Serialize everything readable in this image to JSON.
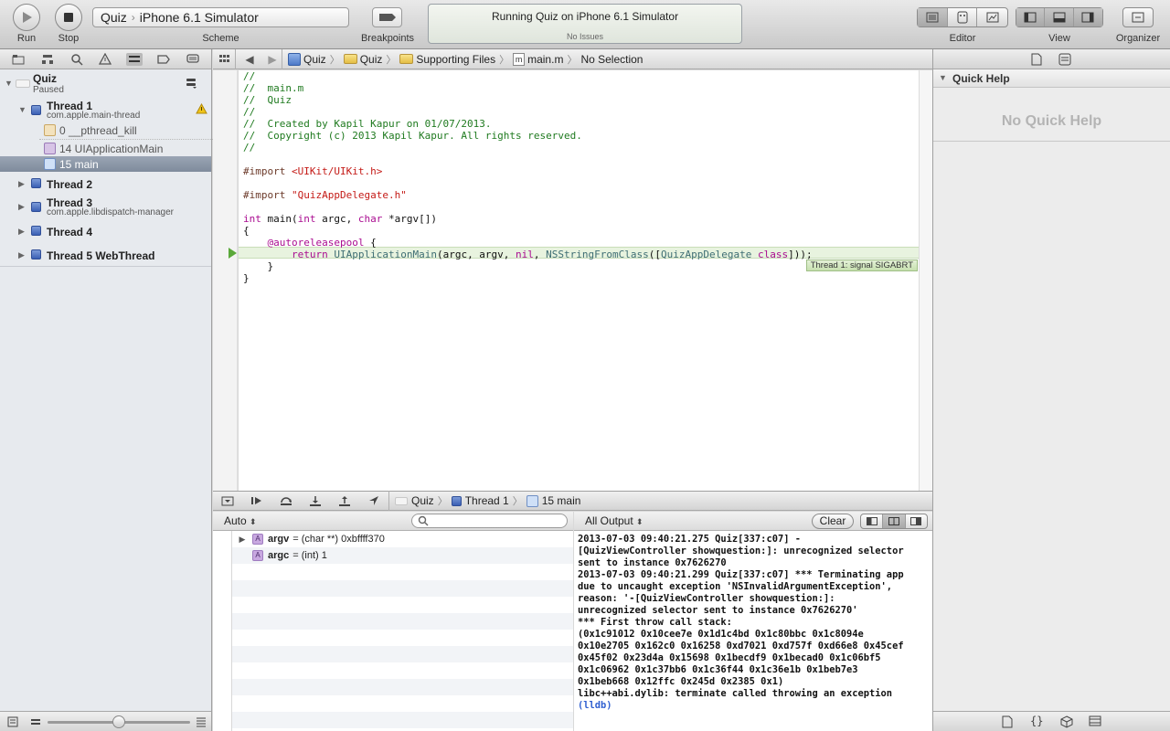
{
  "toolbar": {
    "run_label": "Run",
    "stop_label": "Stop",
    "scheme_label": "Scheme",
    "scheme_project": "Quiz",
    "scheme_destination": "iPhone 6.1 Simulator",
    "breakpoints_label": "Breakpoints",
    "activity_status": "Running Quiz on iPhone 6.1 Simulator",
    "activity_issues": "No Issues",
    "editor_label": "Editor",
    "view_label": "View",
    "organizer_label": "Organizer"
  },
  "navigator": {
    "process_name": "Quiz",
    "process_state": "Paused",
    "threads": [
      {
        "title": "Thread 1",
        "queue": "com.apple.main-thread",
        "expanded": true,
        "warning": true,
        "frames": [
          {
            "label": "0 __pthread_kill"
          },
          {
            "label": "14 UIApplicationMain"
          },
          {
            "label": "15 main",
            "selected": true
          }
        ]
      },
      {
        "title": "Thread 2",
        "queue": ""
      },
      {
        "title": "Thread 3",
        "queue": "com.apple.libdispatch-manager"
      },
      {
        "title": "Thread 4",
        "queue": ""
      },
      {
        "title": "Thread 5 WebThread",
        "queue": ""
      }
    ]
  },
  "jumpbar": {
    "crumbs": [
      "Quiz",
      "Quiz",
      "Supporting Files",
      "main.m",
      "No Selection"
    ]
  },
  "editor": {
    "lines": [
      "//",
      "//  main.m",
      "//  Quiz",
      "//",
      "//  Created by Kapil Kapur on 01/07/2013.",
      "//  Copyright (c) 2013 Kapil Kapur. All rights reserved.",
      "//",
      "",
      "#import <UIKit/UIKit.h>",
      "",
      "#import \"QuizAppDelegate.h\"",
      "",
      "int main(int argc, char *argv[])",
      "{",
      "    @autoreleasepool {",
      "        return UIApplicationMain(argc, argv, nil, NSStringFromClass([QuizAppDelegate class]));",
      "    }",
      "}"
    ],
    "error_badge": "Thread 1: signal SIGABRT"
  },
  "debugbar": {
    "crumbs": [
      "Quiz",
      "Thread 1",
      "15 main"
    ]
  },
  "variables": {
    "scope": "Auto",
    "search_placeholder": "",
    "rows": [
      {
        "name": "argv",
        "value": "= (char **) 0xbffff370",
        "expandable": true
      },
      {
        "name": "argc",
        "value": "= (int) 1",
        "expandable": false
      }
    ]
  },
  "console": {
    "filter": "All Output",
    "clear_label": "Clear",
    "lines": [
      "2013-07-03 09:40:21.275 Quiz[337:c07] -",
      "[QuizViewController showquestion:]: unrecognized selector",
      "sent to instance 0x7626270",
      "2013-07-03 09:40:21.299 Quiz[337:c07] *** Terminating app",
      "due to uncaught exception 'NSInvalidArgumentException',",
      "reason: '-[QuizViewController showquestion:]:",
      "unrecognized selector sent to instance 0x7626270'",
      "*** First throw call stack:",
      "(0x1c91012 0x10cee7e 0x1d1c4bd 0x1c80bbc 0x1c8094e",
      "0x10e2705 0x162c0 0x16258 0xd7021 0xd757f 0xd66e8 0x45cef",
      "0x45f02 0x23d4a 0x15698 0x1becdf9 0x1becad0 0x1c06bf5",
      "0x1c06962 0x1c37bb6 0x1c36f44 0x1c36e1b 0x1beb7e3",
      "0x1beb668 0x12ffc 0x245d 0x2385 0x1)",
      "libc++abi.dylib: terminate called throwing an exception"
    ],
    "prompt": "(lldb)"
  },
  "utilities": {
    "section_title": "Quick Help",
    "empty_text": "No Quick Help"
  },
  "colors": {
    "comment": "#1f7a1f",
    "keyword": "#aa0d91",
    "string": "#c41a16",
    "error_highlight": "#e8f3df",
    "lldb_prompt": "#2f5fd0"
  }
}
